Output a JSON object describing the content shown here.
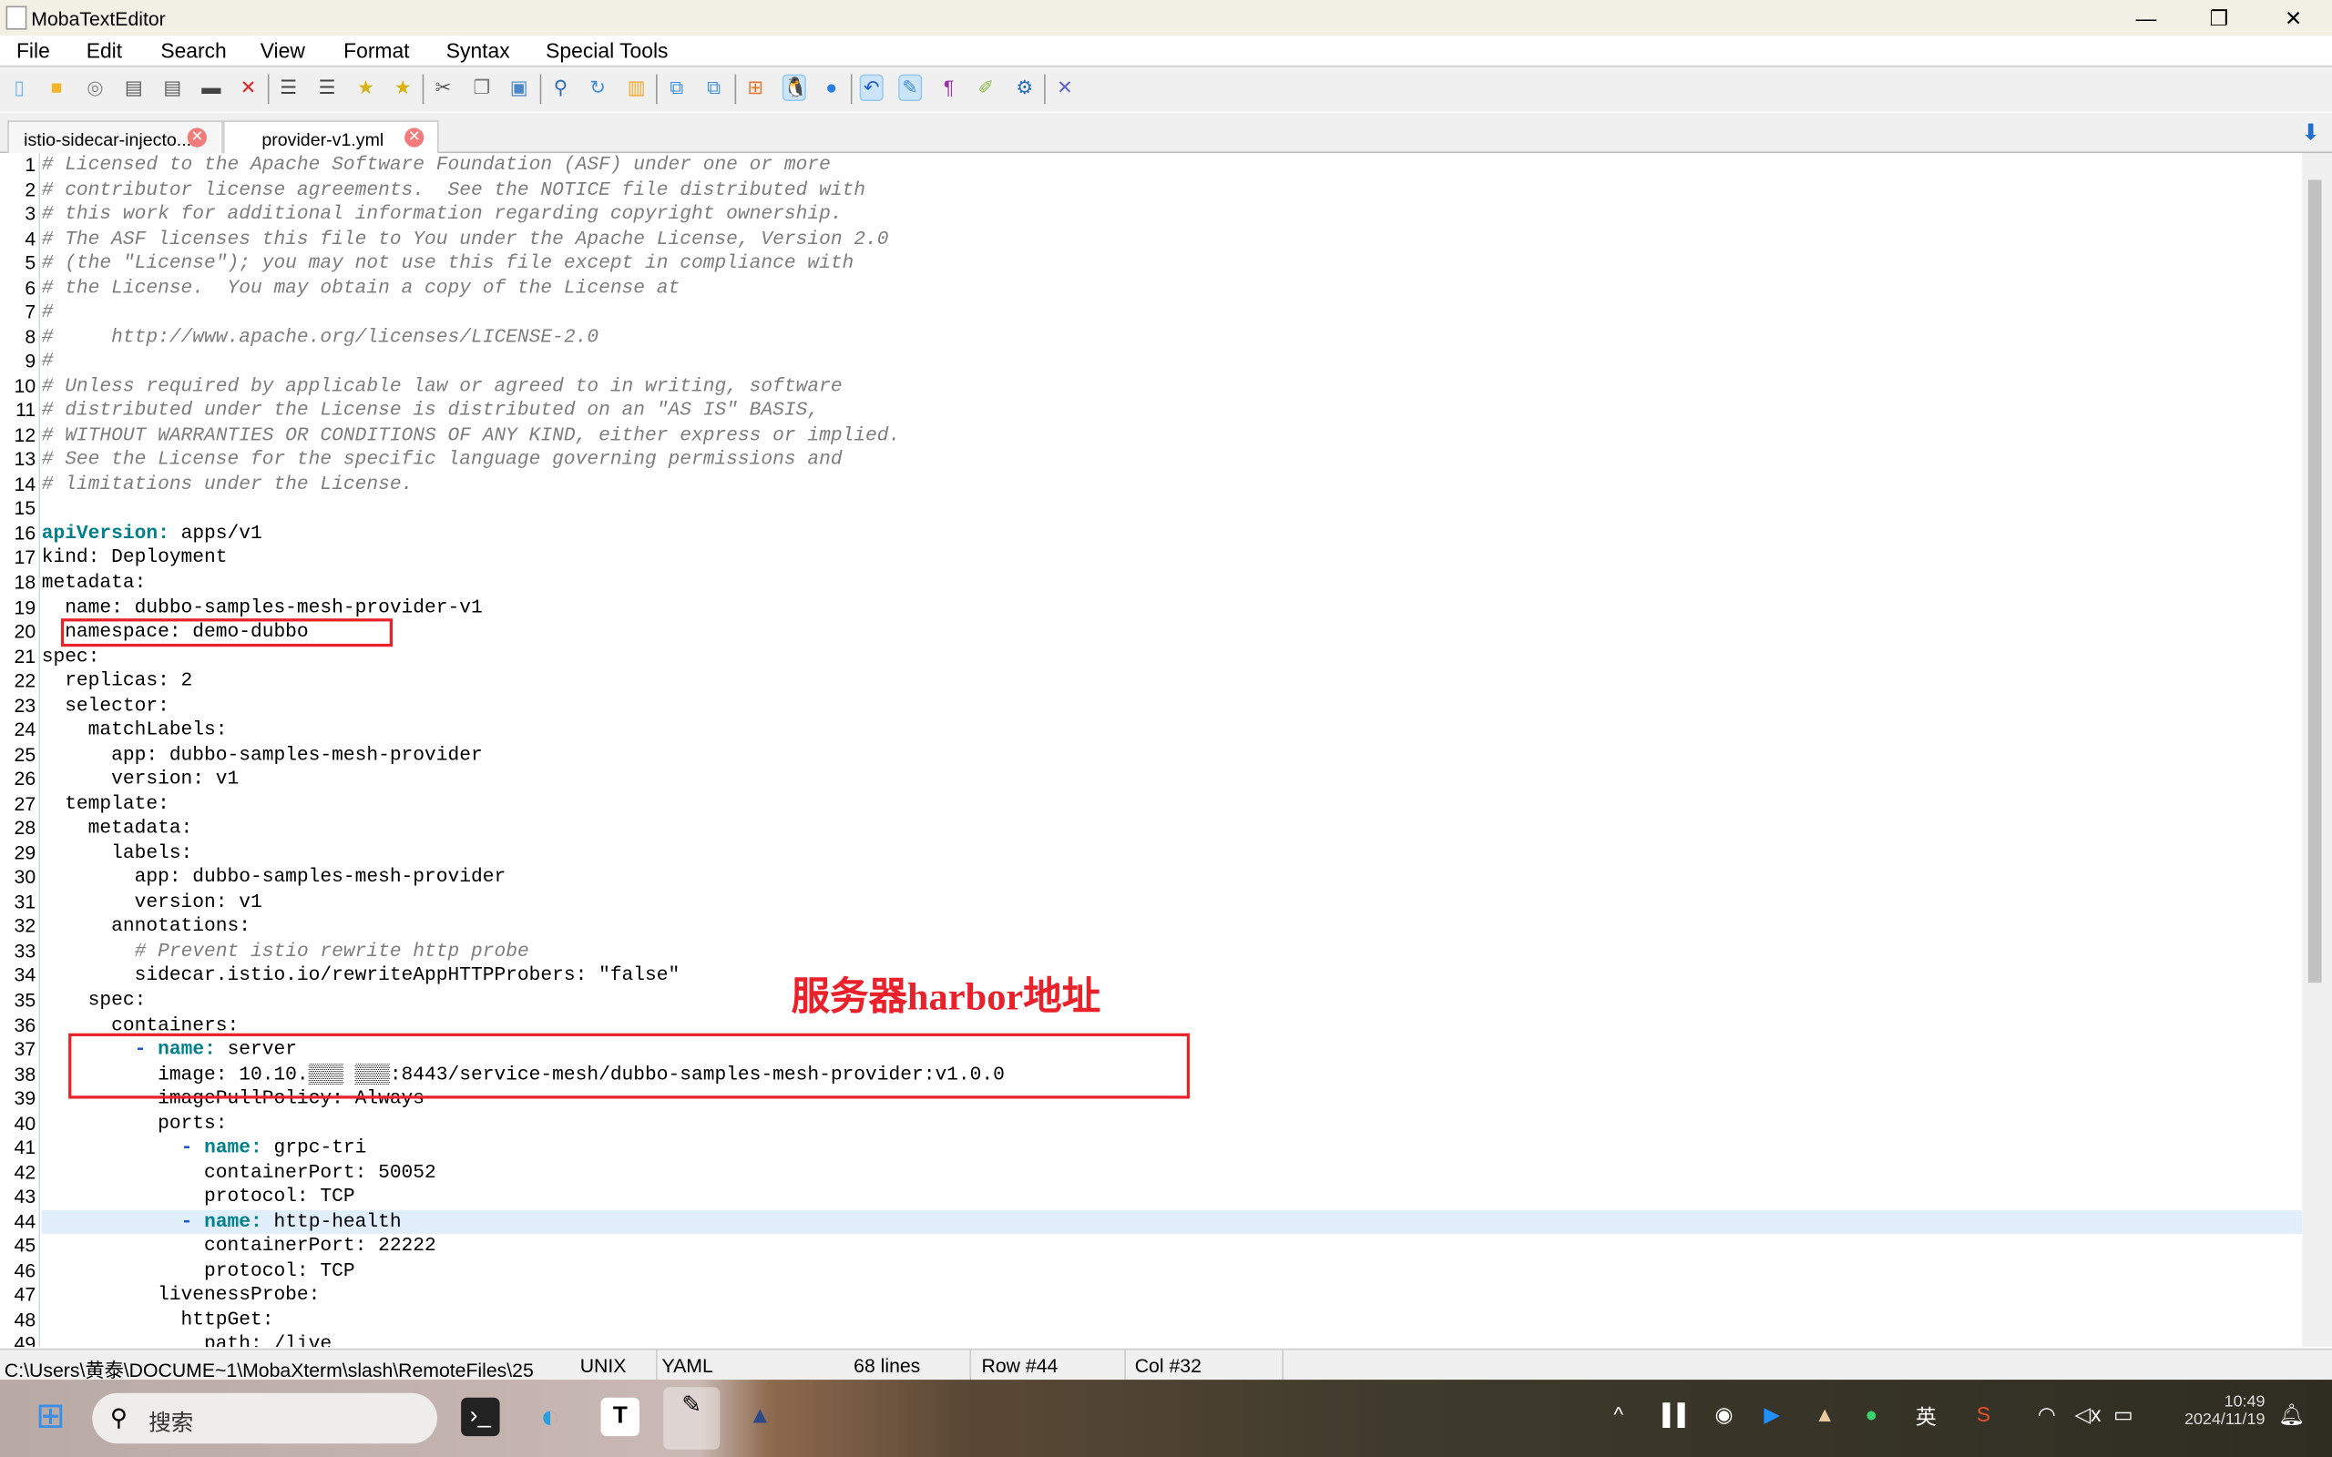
{
  "window": {
    "title": "MobaTextEditor",
    "controls": {
      "minimize": "—",
      "maximize": "❐",
      "close": "✕"
    }
  },
  "menu": [
    "File",
    "Edit",
    "Search",
    "View",
    "Format",
    "Syntax",
    "Special Tools"
  ],
  "toolbar": [
    {
      "icon": "new-file-icon",
      "glyph": "▯",
      "color": "#6fb3f0"
    },
    {
      "icon": "open-folder-icon",
      "glyph": "■",
      "color": "#f5b52b"
    },
    {
      "icon": "reload-icon",
      "glyph": "◎",
      "color": "#888"
    },
    {
      "icon": "save-icon",
      "glyph": "▤",
      "color": "#555"
    },
    {
      "icon": "save-all-icon",
      "glyph": "▤",
      "color": "#555"
    },
    {
      "icon": "print-icon",
      "glyph": "▬",
      "color": "#444"
    },
    {
      "icon": "close-file-icon",
      "glyph": "✕",
      "color": "#e02020"
    },
    {
      "icon": "indent-decrease-icon",
      "glyph": "☰",
      "color": "#444"
    },
    {
      "icon": "indent-increase-icon",
      "glyph": "☰",
      "color": "#444"
    },
    {
      "icon": "bookmark-icon",
      "glyph": "★",
      "color": "#d9b314"
    },
    {
      "icon": "next-bookmark-icon",
      "glyph": "★",
      "color": "#d9b314"
    },
    {
      "icon": "cut-icon",
      "glyph": "✂",
      "color": "#555"
    },
    {
      "icon": "copy-icon",
      "glyph": "❐",
      "color": "#777"
    },
    {
      "icon": "paste-icon",
      "glyph": "▣",
      "color": "#4a86c8"
    },
    {
      "icon": "find-icon",
      "glyph": "⚲",
      "color": "#2a6bbf"
    },
    {
      "icon": "replace-icon",
      "glyph": "↻",
      "color": "#3c8fe0"
    },
    {
      "icon": "goto-icon",
      "glyph": "▥",
      "color": "#f5a623"
    },
    {
      "icon": "compare-icon",
      "glyph": "⧉",
      "color": "#3c8fe0"
    },
    {
      "icon": "merge-icon",
      "glyph": "⧉",
      "color": "#3c8fe0"
    },
    {
      "icon": "windows-eol-icon",
      "glyph": "⊞",
      "color": "#e8742b"
    },
    {
      "icon": "linux-eol-icon",
      "glyph": "🐧",
      "color": "#222"
    },
    {
      "icon": "mac-eol-icon",
      "glyph": "●",
      "color": "#2a7de1"
    },
    {
      "icon": "undo-icon",
      "glyph": "↶",
      "color": "#1e5ad0"
    },
    {
      "icon": "edit-icon",
      "glyph": "✎",
      "color": "#3c8fe0"
    },
    {
      "icon": "pilcrow-icon",
      "glyph": "¶",
      "color": "#9b2fae"
    },
    {
      "icon": "highlight-icon",
      "glyph": "✐",
      "color": "#8bc34a"
    },
    {
      "icon": "settings-icon",
      "glyph": "⚙",
      "color": "#2a6bbf"
    },
    {
      "icon": "exit-icon",
      "glyph": "✕",
      "color": "#5b5fd6"
    }
  ],
  "tabs": [
    {
      "label": "istio-sidecar-injecto...",
      "active": false
    },
    {
      "label": "provider-v1.yml",
      "active": true
    }
  ],
  "editor": {
    "highlighted_line": 44,
    "lines": [
      [
        [
          "cm",
          "# Licensed to the Apache Software Foundation (ASF) under one or more"
        ]
      ],
      [
        [
          "cm",
          "# contributor license agreements.  See the NOTICE file distributed with"
        ]
      ],
      [
        [
          "cm",
          "# this work for additional information regarding copyright ownership."
        ]
      ],
      [
        [
          "cm",
          "# The ASF licenses this file to You under the Apache License, Version 2.0"
        ]
      ],
      [
        [
          "cm",
          "# (the \"License\"); you may not use this file except in compliance with"
        ]
      ],
      [
        [
          "cm",
          "# the License.  You may obtain a copy of the License at"
        ]
      ],
      [
        [
          "cm",
          "#"
        ]
      ],
      [
        [
          "cm",
          "#     http://www.apache.org/licenses/LICENSE-2.0"
        ]
      ],
      [
        [
          "cm",
          "#"
        ]
      ],
      [
        [
          "cm",
          "# Unless required by applicable law or agreed to in writing, software"
        ]
      ],
      [
        [
          "cm",
          "# distributed under the License is distributed on an \"AS IS\" BASIS,"
        ]
      ],
      [
        [
          "cm",
          "# WITHOUT WARRANTIES OR CONDITIONS OF ANY KIND, either express or implied."
        ]
      ],
      [
        [
          "cm",
          "# See the License for the specific language governing permissions and"
        ]
      ],
      [
        [
          "cm",
          "# limitations under the License."
        ]
      ],
      [],
      [
        [
          "kw",
          "apiVersion:"
        ],
        [
          "tx",
          " apps/v1"
        ]
      ],
      [
        [
          "tx",
          "kind: Deployment"
        ]
      ],
      [
        [
          "tx",
          "metadata:"
        ]
      ],
      [
        [
          "tx",
          "  name: dubbo-samples-mesh-provider-v1"
        ]
      ],
      [
        [
          "tx",
          "  namespace: demo-dubbo"
        ]
      ],
      [
        [
          "tx",
          "spec:"
        ]
      ],
      [
        [
          "tx",
          "  replicas: 2"
        ]
      ],
      [
        [
          "tx",
          "  selector:"
        ]
      ],
      [
        [
          "tx",
          "    matchLabels:"
        ]
      ],
      [
        [
          "tx",
          "      app: dubbo-samples-mesh-provider"
        ]
      ],
      [
        [
          "tx",
          "      version: v1"
        ]
      ],
      [
        [
          "tx",
          "  template:"
        ]
      ],
      [
        [
          "tx",
          "    metadata:"
        ]
      ],
      [
        [
          "tx",
          "      labels:"
        ]
      ],
      [
        [
          "tx",
          "        app: dubbo-samples-mesh-provider"
        ]
      ],
      [
        [
          "tx",
          "        version: v1"
        ]
      ],
      [
        [
          "tx",
          "      annotations:"
        ]
      ],
      [
        [
          "tx",
          "        "
        ],
        [
          "cm",
          "# Prevent istio rewrite http probe"
        ]
      ],
      [
        [
          "tx",
          "        sidecar.istio.io/rewriteAppHTTPProbers: \"false\""
        ]
      ],
      [
        [
          "tx",
          "    spec:"
        ]
      ],
      [
        [
          "tx",
          "      containers:"
        ]
      ],
      [
        [
          "tx",
          "        "
        ],
        [
          "da",
          "-"
        ],
        [
          "tx",
          " "
        ],
        [
          "kw",
          "name:"
        ],
        [
          "tx",
          " server"
        ]
      ],
      [
        [
          "tx",
          "          image: 10.10.▒▒▒ ▒▒▒:8443/service-mesh/dubbo-samples-mesh-provider:v1.0.0"
        ]
      ],
      [
        [
          "tx",
          "          imagePullPolicy: Always"
        ]
      ],
      [
        [
          "tx",
          "          ports:"
        ]
      ],
      [
        [
          "tx",
          "            "
        ],
        [
          "da",
          "-"
        ],
        [
          "tx",
          " "
        ],
        [
          "kw",
          "name:"
        ],
        [
          "tx",
          " grpc-tri"
        ]
      ],
      [
        [
          "tx",
          "              containerPort: 50052"
        ]
      ],
      [
        [
          "tx",
          "              protocol: TCP"
        ]
      ],
      [
        [
          "tx",
          "            "
        ],
        [
          "da",
          "-"
        ],
        [
          "tx",
          " "
        ],
        [
          "kw",
          "name:"
        ],
        [
          "tx",
          " http-health"
        ]
      ],
      [
        [
          "tx",
          "              containerPort: 22222"
        ]
      ],
      [
        [
          "tx",
          "              protocol: TCP"
        ]
      ],
      [
        [
          "tx",
          "          livenessProbe:"
        ]
      ],
      [
        [
          "tx",
          "            httpGet:"
        ]
      ],
      [
        [
          "tx",
          "              path: /live"
        ]
      ]
    ]
  },
  "annotation": {
    "text": "服务器harbor地址",
    "color": "#e8212b"
  },
  "statusbar": {
    "path": "C:\\Users\\黄泰\\DOCUME~1\\MobaXterm\\slash\\RemoteFiles\\25",
    "eol": "UNIX",
    "syntax": "YAML",
    "lines": "68 lines",
    "row": "Row #44",
    "col": "Col #32"
  },
  "taskbar": {
    "search_placeholder": "搜索",
    "tray_lang": "英",
    "time": "10:49",
    "date": "2024/11/19"
  }
}
